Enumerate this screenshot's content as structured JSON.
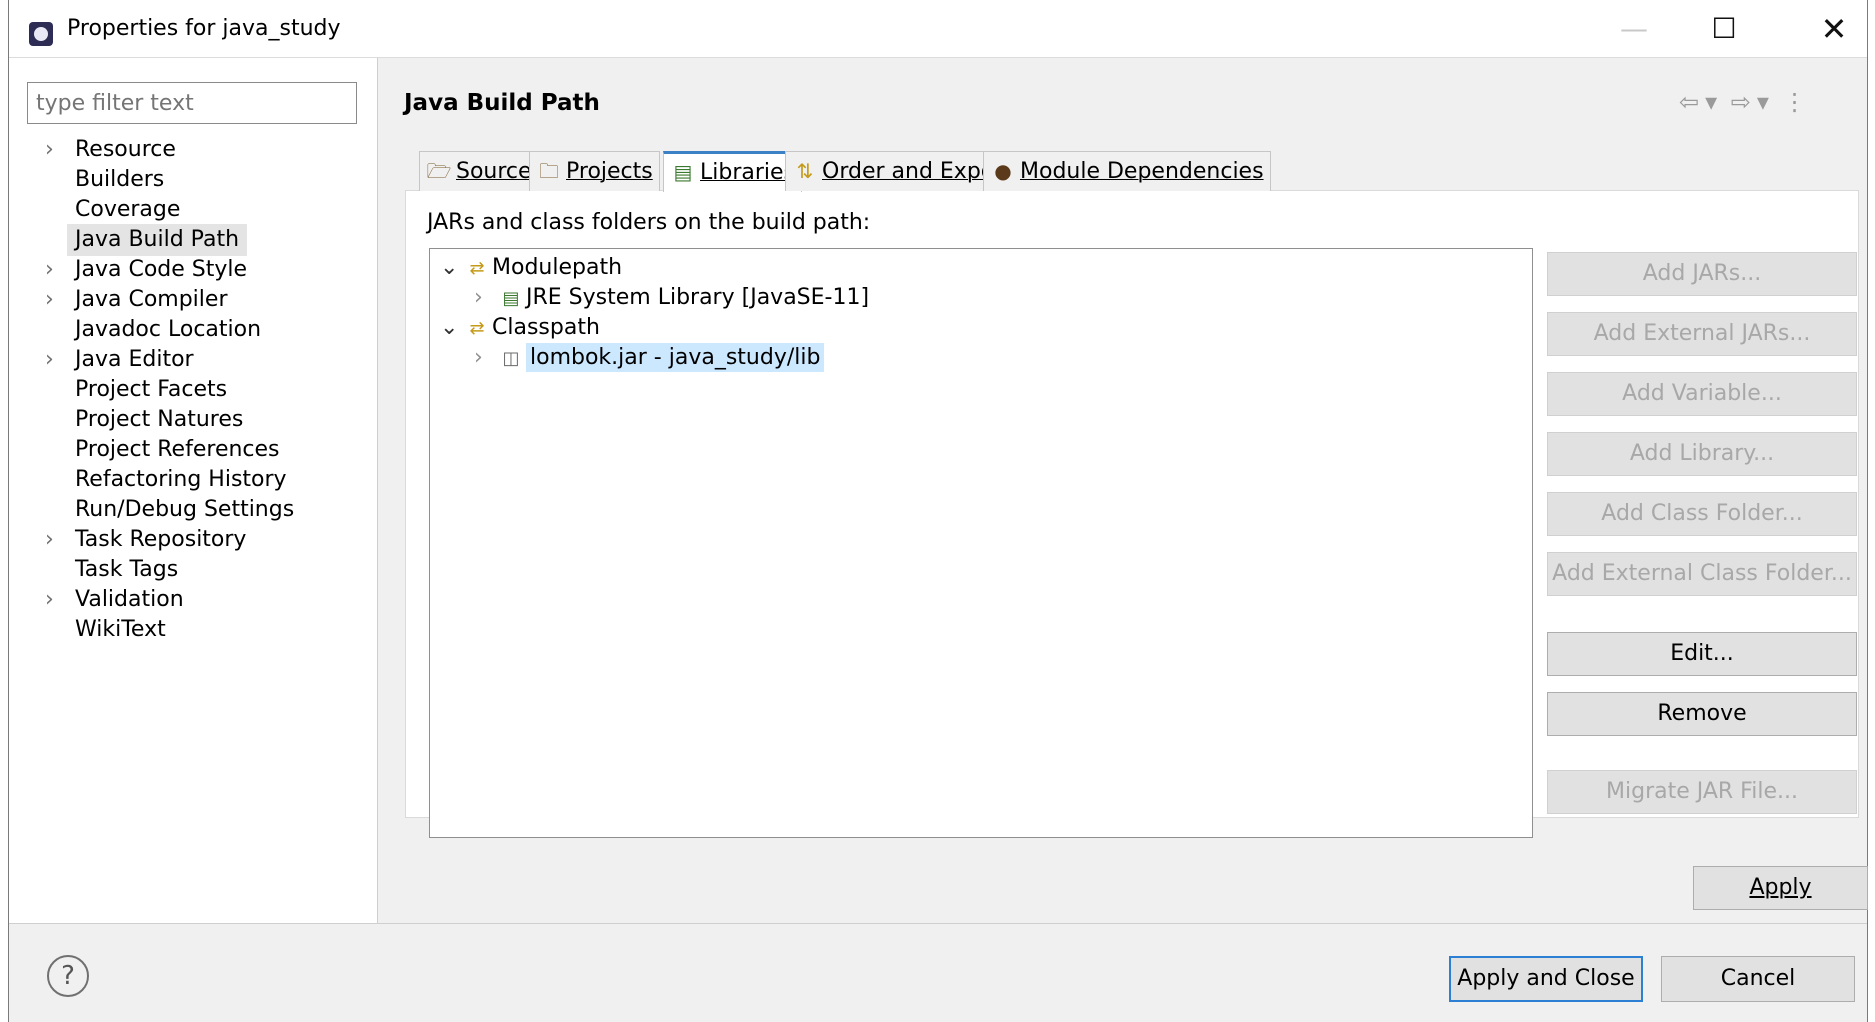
{
  "window": {
    "title": "Properties for java_study",
    "minimize_glyph": "—",
    "maximize_glyph": "☐",
    "close_glyph": "✕"
  },
  "filter": {
    "placeholder": "type filter text",
    "value": ""
  },
  "nav": {
    "items": [
      {
        "label": "Resource",
        "expandable": true
      },
      {
        "label": "Builders",
        "expandable": false
      },
      {
        "label": "Coverage",
        "expandable": false
      },
      {
        "label": "Java Build Path",
        "expandable": false,
        "selected": true
      },
      {
        "label": "Java Code Style",
        "expandable": true
      },
      {
        "label": "Java Compiler",
        "expandable": true
      },
      {
        "label": "Javadoc Location",
        "expandable": false
      },
      {
        "label": "Java Editor",
        "expandable": true
      },
      {
        "label": "Project Facets",
        "expandable": false
      },
      {
        "label": "Project Natures",
        "expandable": false
      },
      {
        "label": "Project References",
        "expandable": false
      },
      {
        "label": "Refactoring History",
        "expandable": false
      },
      {
        "label": "Run/Debug Settings",
        "expandable": false
      },
      {
        "label": "Task Repository",
        "expandable": true
      },
      {
        "label": "Task Tags",
        "expandable": false
      },
      {
        "label": "Validation",
        "expandable": true
      },
      {
        "label": "WikiText",
        "expandable": false
      }
    ]
  },
  "page": {
    "title": "Java Build Path"
  },
  "tabs": [
    {
      "label": "Source",
      "icon": "source-folder-icon",
      "active": false
    },
    {
      "label": "Projects",
      "icon": "projects-folder-icon",
      "active": false
    },
    {
      "label": "Libraries",
      "icon": "libraries-icon",
      "active": true
    },
    {
      "label": "Order and Export",
      "icon": "order-export-icon",
      "active": false
    },
    {
      "label": "Module Dependencies",
      "icon": "module-icon",
      "active": false
    }
  ],
  "libraries": {
    "label": "JARs and class folders on the build path:",
    "tree": [
      {
        "label": "Modulepath",
        "level": 0,
        "expanded": true,
        "icon": "path-icon"
      },
      {
        "label": "JRE System Library [JavaSE-11]",
        "level": 1,
        "expanded": false,
        "icon": "library-icon"
      },
      {
        "label": "Classpath",
        "level": 0,
        "expanded": true,
        "icon": "path-icon"
      },
      {
        "label": "lombok.jar - java_study/lib",
        "level": 1,
        "expanded": false,
        "icon": "jar-icon",
        "selected": true
      }
    ]
  },
  "side_buttons": [
    {
      "label": "Add JARs...",
      "enabled": false
    },
    {
      "label": "Add External JARs...",
      "enabled": false
    },
    {
      "label": "Add Variable...",
      "enabled": false
    },
    {
      "label": "Add Library...",
      "enabled": false
    },
    {
      "label": "Add Class Folder...",
      "enabled": false
    },
    {
      "label": "Add External Class Folder...",
      "enabled": false
    },
    {
      "label": "Edit...",
      "enabled": true
    },
    {
      "label": "Remove",
      "enabled": true
    },
    {
      "label": "Migrate JAR File...",
      "enabled": false
    }
  ],
  "footer": {
    "apply_label": "Apply",
    "apply_close_label": "Apply and Close",
    "cancel_label": "Cancel",
    "help_glyph": "?"
  },
  "colors": {
    "accent": "#2d7fd4",
    "selection": "#cce8ff",
    "nav_selection": "#e4e4e4"
  }
}
